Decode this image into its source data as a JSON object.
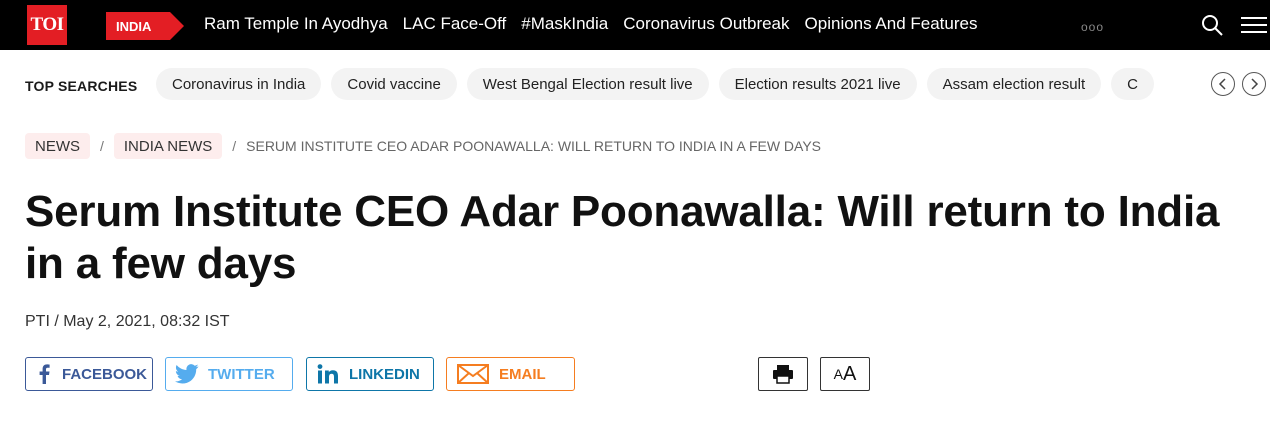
{
  "topnav": {
    "logo": "TOI",
    "edition": "INDIA",
    "links": [
      "Ram Temple In Ayodhya",
      "LAC Face-Off",
      "#MaskIndia",
      "Coronavirus Outbreak",
      "Opinions And Features"
    ],
    "more": "ooo"
  },
  "top_searches": {
    "label": "TOP SEARCHES",
    "items": [
      "Coronavirus in India",
      "Covid vaccine",
      "West Bengal Election result live",
      "Election results 2021 live",
      "Assam election result",
      "C"
    ]
  },
  "breadcrumb": {
    "items": [
      "NEWS",
      "INDIA NEWS"
    ],
    "separator": "/",
    "current": "SERUM INSTITUTE CEO ADAR POONAWALLA: WILL RETURN TO INDIA IN A FEW DAYS"
  },
  "article": {
    "headline": "Serum Institute CEO Adar Poonawalla: Will return to India in a few days",
    "byline": "PTI / May 2, 2021, 08:32 IST"
  },
  "share": {
    "facebook": "FACEBOOK",
    "twitter": "TWITTER",
    "linkedin": "LINKEDIN",
    "email": "EMAIL"
  },
  "tools": {
    "font_size_small": "A",
    "font_size_large": "A"
  },
  "colors": {
    "brand_red": "#e31e24",
    "facebook": "#3b5998",
    "twitter": "#55acee",
    "linkedin": "#0e76a8",
    "email": "#f57d20"
  }
}
